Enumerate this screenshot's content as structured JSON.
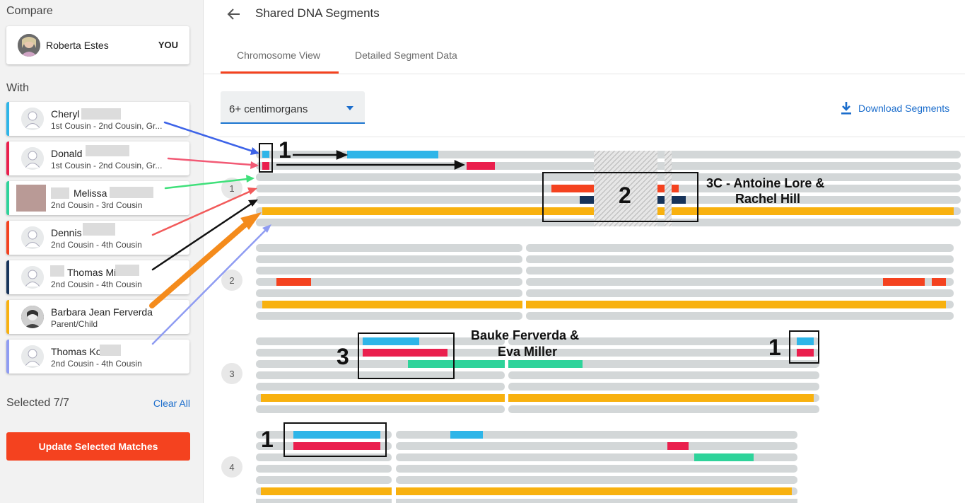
{
  "sidebar": {
    "compare_label": "Compare",
    "you_name": "Roberta Estes",
    "you_badge": "YOU",
    "with_label": "With",
    "matches": [
      {
        "name": "Cheryl",
        "relationship": "1st Cousin - 2nd Cousin, Gr...",
        "color": "#2eb5e8"
      },
      {
        "name": "Donald",
        "relationship": "1st Cousin - 2nd Cousin, Gr...",
        "color": "#ea1f4d"
      },
      {
        "name": "Melissa",
        "relationship": "2nd Cousin - 3rd Cousin",
        "color": "#2ed39a"
      },
      {
        "name": "Dennis",
        "relationship": "2nd Cousin - 4th Cousin",
        "color": "#f4421f"
      },
      {
        "name": "Thomas Mi",
        "relationship": "2nd Cousin - 4th Cousin",
        "color": "#16335a"
      },
      {
        "name": "Barbara Jean Ferverda",
        "relationship": "Parent/Child",
        "color": "#f8b10f"
      },
      {
        "name": "Thomas Ko",
        "relationship": "2nd Cousin - 4th Cousin",
        "color": "#8f9cf2"
      }
    ],
    "selected_label": "Selected 7/7",
    "clear_all": "Clear All",
    "update_button": "Update Selected Matches"
  },
  "header": {
    "back_icon": "arrow-back-icon",
    "title": "Shared DNA Segments"
  },
  "tabs": [
    {
      "label": "Chromosome View",
      "active": true
    },
    {
      "label": "Detailed Segment Data",
      "active": false
    }
  ],
  "filter": {
    "selected": "6+ centimorgans"
  },
  "download": {
    "icon": "download-icon",
    "label": "Download Segments"
  },
  "chromosomes": [
    {
      "number": "1"
    },
    {
      "number": "2"
    },
    {
      "number": "3"
    },
    {
      "number": "4"
    }
  ],
  "annotations": {
    "ch1_num": "1",
    "ch1_region_num": "2",
    "ch1_region_label_line1": "3C - Antoine Lore &",
    "ch1_region_label_line2": "Rachel Hill",
    "ch3_region_num": "3",
    "ch3_region_label_line1": "Bauke Ferverda &",
    "ch3_region_label_line2": "Eva Miller",
    "ch3_right_num": "1",
    "ch4_num": "1"
  },
  "colors": {
    "accent": "#f4421f",
    "link": "#1b6dcc",
    "track": "#d3d7d8"
  }
}
